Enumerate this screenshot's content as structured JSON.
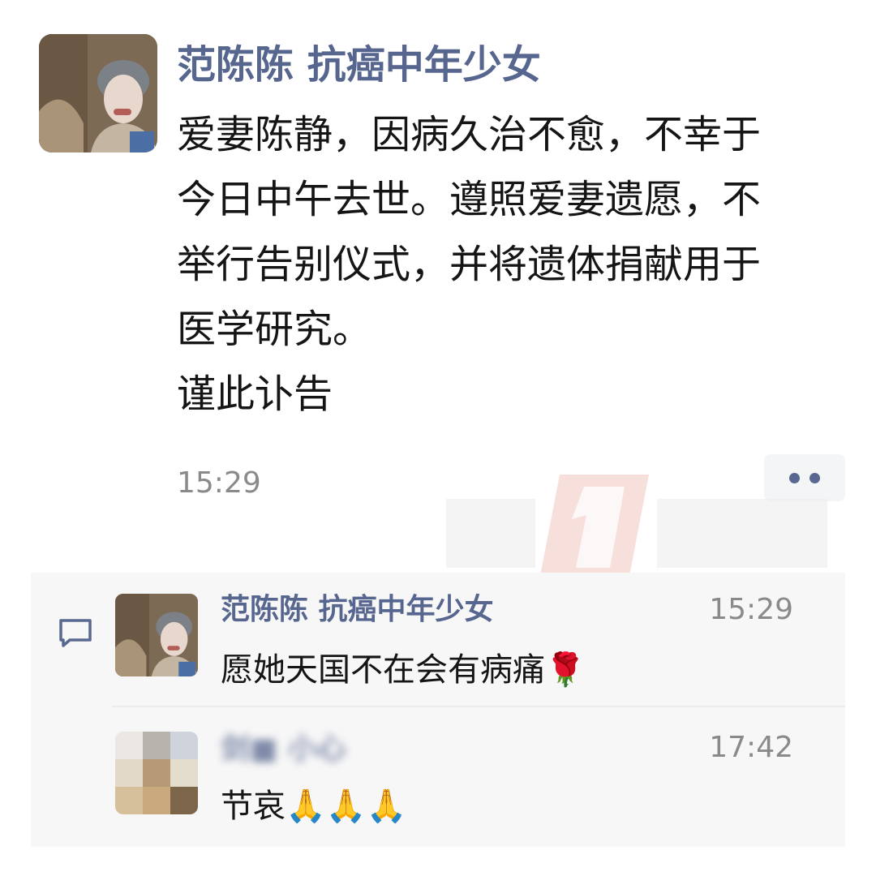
{
  "post": {
    "author": "范陈陈 抗癌中年少女",
    "lines": [
      "爱妻陈静，因病久治不愈，不幸于",
      "今日中午去世。遵照爱妻遗愿，不",
      "举行告别仪式，并将遗体捐献用于",
      "医学研究。",
      "谨此讣告"
    ],
    "time": "15:29",
    "more_icon": "more-dots-icon"
  },
  "comments": [
    {
      "author": "范陈陈 抗癌中年少女",
      "time": "15:29",
      "text": "愿她天国不在会有病痛🌹"
    },
    {
      "author": "剑■ 小心",
      "time": "17:42",
      "text": "节哀🙏🙏🙏"
    }
  ],
  "icons": {
    "comment": "comment-bubble-icon",
    "watermark": "first-scene-logo-watermark"
  },
  "colors": {
    "name": "#57668f",
    "text": "#151515",
    "time": "#8a8a8a",
    "comment_bg": "#f7f7f7"
  }
}
